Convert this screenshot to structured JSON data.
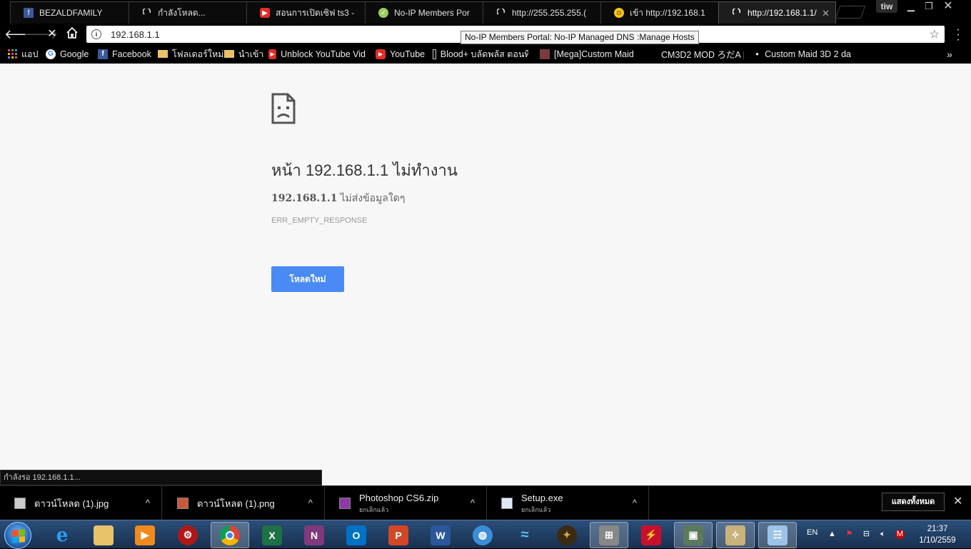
{
  "tabs": [
    {
      "title": "BEZALDFAMILY",
      "icon": "facebook-icon"
    },
    {
      "title": "กำลังโหลด...",
      "icon": "loading-spinner-icon"
    },
    {
      "title": "สอนการเปิดเซิฟ ts3 -",
      "icon": "youtube-icon"
    },
    {
      "title": "No-IP Members Por",
      "icon": "noip-icon"
    },
    {
      "title": "http://255.255.255.(",
      "icon": "loading-spinner-icon"
    },
    {
      "title": "เข้า http://192.168.1",
      "icon": "emoji-icon"
    },
    {
      "title": "http://192.168.1.1/",
      "icon": "loading-spinner-icon",
      "active": true
    }
  ],
  "profile": "tiw",
  "omnibox": {
    "url": "192.168.1.1"
  },
  "tooltip": "No-IP Members Portal: No-IP Managed DNS :Manage Hosts",
  "bookmarks": [
    {
      "label": "แอป",
      "icon": "apps-grid-icon"
    },
    {
      "label": "Google",
      "icon": "google-icon"
    },
    {
      "label": "Facebook",
      "icon": "facebook-icon"
    },
    {
      "label": "โฟลเดอร์ใหม่",
      "icon": "folder-icon"
    },
    {
      "label": "นำเข้า",
      "icon": "folder-icon"
    },
    {
      "label": "Unblock YouTube Vid",
      "icon": "youtube-icon"
    },
    {
      "label": "YouTube",
      "icon": "youtube-icon"
    },
    {
      "label": "Blood+ บลัดพลัส ตอนที",
      "icon": "page-icon"
    },
    {
      "label": "[Mega]Custom Maid",
      "icon": "thumbnail-icon"
    },
    {
      "label": "CM3D2 MOD ろだA |",
      "icon": "none"
    },
    {
      "label": "Custom Maid 3D 2 da",
      "icon": "dot-icon"
    }
  ],
  "error": {
    "title": "หน้า 192.168.1.1 ไม่ทำงาน",
    "host": "192.168.1.1",
    "desc": "ไม่ส่งข้อมูลใดๆ",
    "code": "ERR_EMPTY_RESPONSE",
    "reload_label": "โหลดใหม่"
  },
  "status": "กำลังรอ 192.168.1.1...",
  "downloads": [
    {
      "name": "ดาวน์โหลด (1).jpg",
      "sub": ""
    },
    {
      "name": "ดาวน์โหลด (1).png",
      "sub": ""
    },
    {
      "name": "Photoshop CS6.zip",
      "sub": "ยกเลิกแล้ว"
    },
    {
      "name": "Setup.exe",
      "sub": "ยกเลิกแล้ว"
    }
  ],
  "show_all_label": "แสดงทั้งหมด",
  "taskbar": {
    "lang": "EN",
    "time": "21:37",
    "date": "1/10/2559"
  }
}
